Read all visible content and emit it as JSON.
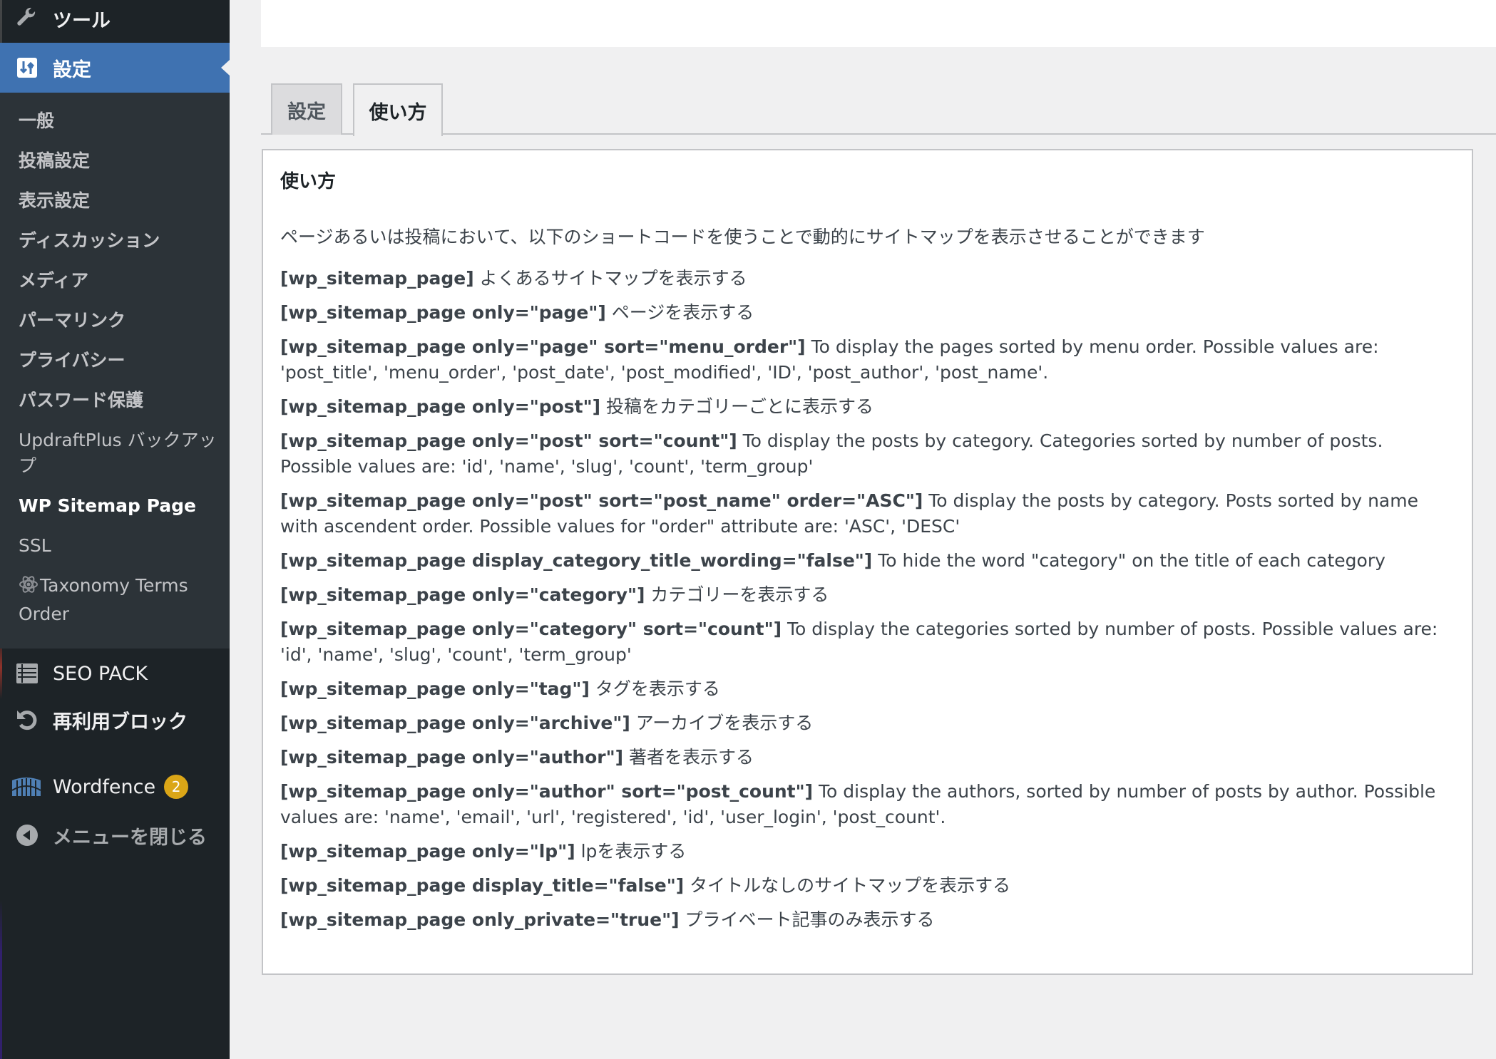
{
  "sidebar": {
    "tools": {
      "label": "ツール",
      "icon": "wrench-icon"
    },
    "settings": {
      "label": "設定",
      "icon": "settings-icon"
    },
    "submenu": [
      {
        "label": "一般"
      },
      {
        "label": "投稿設定"
      },
      {
        "label": "表示設定"
      },
      {
        "label": "ディスカッション"
      },
      {
        "label": "メディア"
      },
      {
        "label": "パーマリンク"
      },
      {
        "label": "プライバシー"
      },
      {
        "label": "パスワード保護"
      },
      {
        "label": "UpdraftPlus バックアップ"
      },
      {
        "label": "WP Sitemap Page"
      },
      {
        "label": "SSL"
      },
      {
        "label": "Taxonomy Terms Order"
      }
    ],
    "seo_pack": {
      "label": "SEO PACK",
      "icon": "list-icon"
    },
    "reusable_blocks": {
      "label": "再利用ブロック",
      "icon": "undo-icon"
    },
    "wordfence": {
      "label": "Wordfence",
      "badge": "2",
      "icon": "wordfence-icon"
    },
    "collapse": {
      "label": "メニューを閉じる",
      "icon": "collapse-arrow-icon"
    },
    "colors": {
      "background": "#1d2327",
      "submenu": "#2c3338",
      "active": "#3f72b1",
      "badge": "#dba617"
    }
  },
  "tabs": [
    {
      "label": "設定",
      "active": false
    },
    {
      "label": "使い方",
      "active": true
    }
  ],
  "panel": {
    "title": "使い方",
    "intro": "ページあるいは投稿において、以下のショートコードを使うことで動的にサイトマップを表示させることができます",
    "rows": [
      {
        "code": "[wp_sitemap_page]",
        "desc": "よくあるサイトマップを表示する"
      },
      {
        "code": "[wp_sitemap_page only=\"page\"]",
        "desc": "ページを表示する"
      },
      {
        "code": "[wp_sitemap_page only=\"page\" sort=\"menu_order\"]",
        "desc": "To display the pages sorted by menu order. Possible values are: 'post_title', 'menu_order', 'post_date', 'post_modified', 'ID', 'post_author', 'post_name'."
      },
      {
        "code": "[wp_sitemap_page only=\"post\"]",
        "desc": "投稿をカテゴリーごとに表示する"
      },
      {
        "code": "[wp_sitemap_page only=\"post\" sort=\"count\"]",
        "desc": "To display the posts by category. Categories sorted by number of posts. Possible values are: 'id', 'name', 'slug', 'count', 'term_group'"
      },
      {
        "code": "[wp_sitemap_page only=\"post\" sort=\"post_name\" order=\"ASC\"]",
        "desc": "To display the posts by category. Posts sorted by name with ascendent order. Possible values for \"order\" attribute are: 'ASC', 'DESC'"
      },
      {
        "code": "[wp_sitemap_page display_category_title_wording=\"false\"]",
        "desc": "To hide the word \"category\" on the title of each category"
      },
      {
        "code": "[wp_sitemap_page only=\"category\"]",
        "desc": "カテゴリーを表示する"
      },
      {
        "code": "[wp_sitemap_page only=\"category\" sort=\"count\"]",
        "desc": "To display the categories sorted by number of posts. Possible values are: 'id', 'name', 'slug', 'count', 'term_group'"
      },
      {
        "code": "[wp_sitemap_page only=\"tag\"]",
        "desc": "タグを表示する"
      },
      {
        "code": "[wp_sitemap_page only=\"archive\"]",
        "desc": "アーカイブを表示する"
      },
      {
        "code": "[wp_sitemap_page only=\"author\"]",
        "desc": "著者を表示する"
      },
      {
        "code": "[wp_sitemap_page only=\"author\" sort=\"post_count\"]",
        "desc": "To display the authors, sorted by number of posts by author. Possible values are: 'name', 'email', 'url', 'registered', 'id', 'user_login', 'post_count'."
      },
      {
        "code": "[wp_sitemap_page only=\"lp\"]",
        "desc": "lpを表示する"
      },
      {
        "code": "[wp_sitemap_page display_title=\"false\"]",
        "desc": "タイトルなしのサイトマップを表示する"
      },
      {
        "code": "[wp_sitemap_page only_private=\"true\"]",
        "desc": "プライベート記事のみ表示する"
      }
    ]
  }
}
